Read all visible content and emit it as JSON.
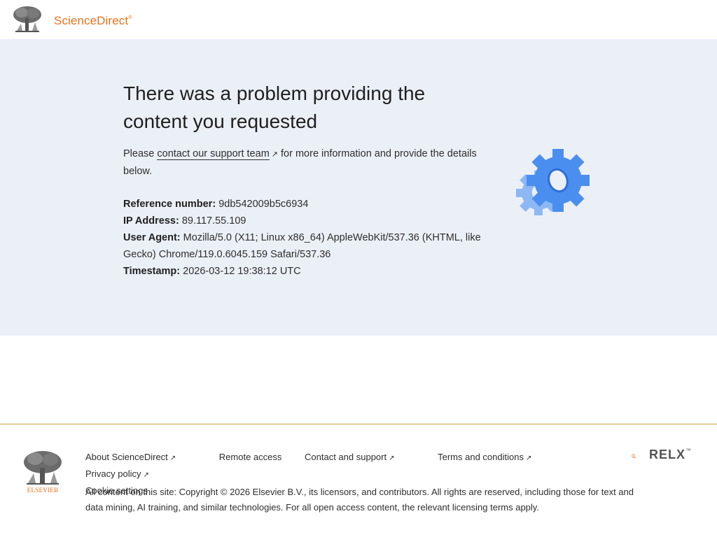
{
  "header": {
    "brand": "ScienceDirect",
    "brand_mark": "®"
  },
  "hero": {
    "title": "There was a problem providing the content you requested",
    "intro_before": "Please ",
    "support_link": "contact our support team",
    "intro_after": " for more information and provide the details below.",
    "reference_label": "Reference number:",
    "reference_value": "9db542009b5c6934",
    "ip_label": "IP Address:",
    "ip_value": "89.117.55.109",
    "ua_label": "User Agent:",
    "ua_value": "Mozilla/5.0 (X11; Linux x86_64) AppleWebKit/537.36 (KHTML, like Gecko) Chrome/119.0.6045.159 Safari/537.36",
    "timestamp_label": "Timestamp:",
    "timestamp_value": "2026-03-12 19:38:12 UTC"
  },
  "footer": {
    "links": [
      {
        "label": "About ScienceDirect",
        "external": true
      },
      {
        "label": "Remote access",
        "external": false
      },
      {
        "label": "Contact and support",
        "external": true
      },
      {
        "label": "Terms and conditions",
        "external": true
      },
      {
        "label": "Privacy policy",
        "external": true
      }
    ],
    "cookie_settings": "Cookie settings",
    "copyright": "All content on this site: Copyright © 2026 Elsevier B.V., its licensors, and contributors. All rights are reserved, including those for text and data mining, AI training, and similar technologies. For all open access content, the relevant licensing terms apply.",
    "elsevier_wordmark": "ELSEVIER",
    "relx": "RELX",
    "relx_tm": "™"
  },
  "icons": [
    "elsevier-tree-icon",
    "external-link-icon",
    "gear-icon",
    "relx-logo-icon"
  ],
  "colors": {
    "brand_orange": "#e9711c",
    "hero_bg": "#ebf0f7",
    "gear_blue": "#4a8ef0",
    "footer_rule": "#c9a043"
  }
}
